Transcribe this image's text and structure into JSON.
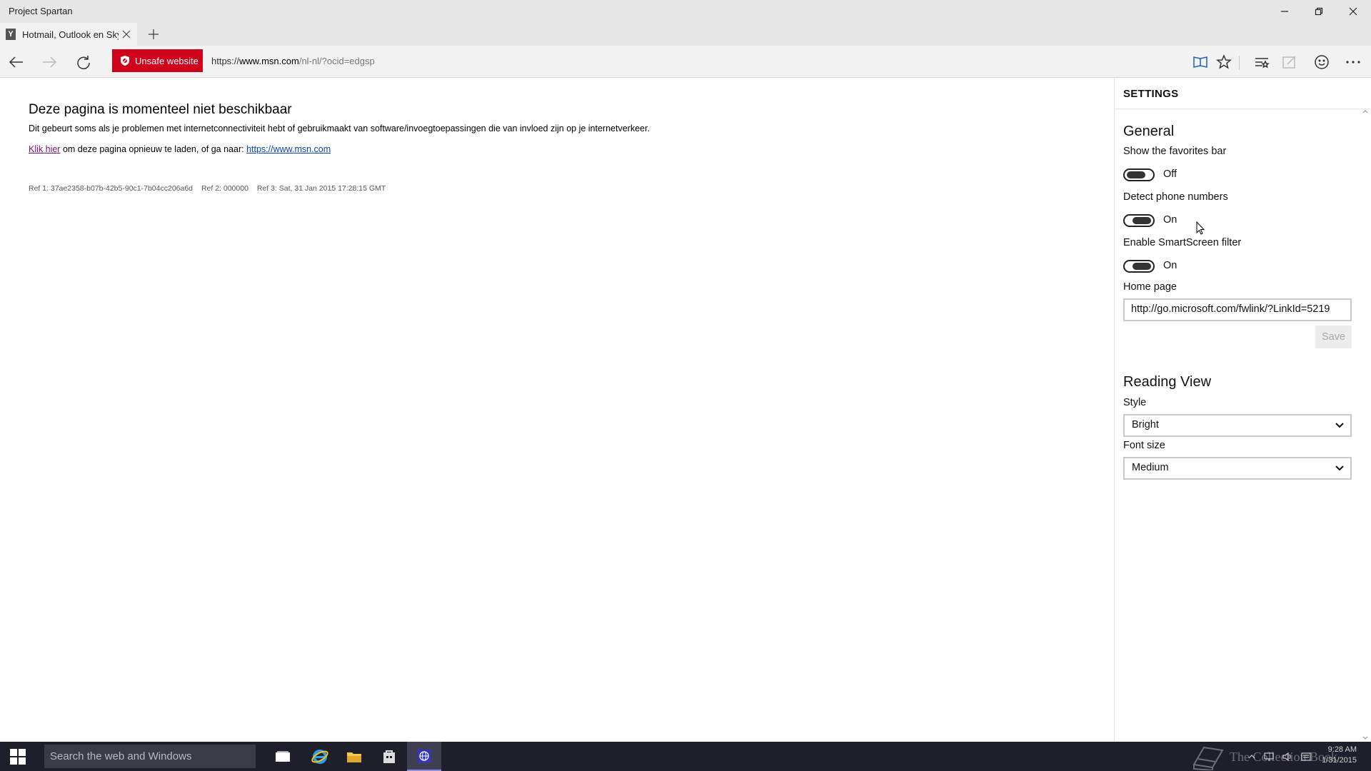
{
  "window": {
    "title": "Project Spartan"
  },
  "tabs": [
    {
      "label": "Hotmail, Outlook en Sky..."
    }
  ],
  "navbar": {
    "unsafe_label": "Unsafe website",
    "url_scheme": "https://",
    "url_host": "www.msn.com",
    "url_path": "/nl-nl/?ocid=edgsp"
  },
  "page": {
    "title": "Deze pagina is momenteel niet beschikbaar",
    "description": "Dit gebeurt soms als je problemen met internetconnectiviteit hebt of gebruikmaakt van software/invoegtoepassingen die van invloed zijn op je internetverkeer.",
    "retry_link": "Klik hier",
    "retry_text": " om deze pagina opnieuw te laden, of ga naar: ",
    "retry_url": "https://www.msn.com",
    "ref1": "Ref 1: 37ae2358-b07b-42b5-90c1-7b04cc206a6d",
    "ref2": "Ref 2: 000000",
    "ref3": "Ref 3: Sat, 31 Jan 2015 17:28:15 GMT"
  },
  "settings": {
    "header": "SETTINGS",
    "general_title": "General",
    "favorites_bar_label": "Show the favorites bar",
    "favorites_bar_state": "Off",
    "phone_numbers_label": "Detect phone numbers",
    "phone_numbers_state": "On",
    "smartscreen_label": "Enable SmartScreen filter",
    "smartscreen_state": "On",
    "home_page_label": "Home page",
    "home_page_value": "http://go.microsoft.com/fwlink/?LinkId=5219",
    "save_label": "Save",
    "reading_view_title": "Reading View",
    "style_label": "Style",
    "style_value": "Bright",
    "font_size_label": "Font size",
    "font_size_value": "Medium"
  },
  "taskbar": {
    "search_placeholder": "Search the web and Windows",
    "watermark": "The Collection Book",
    "time": "9:28 AM",
    "date": "1/31/2015"
  },
  "icons": {
    "back": "back-arrow-icon",
    "forward": "forward-arrow-icon",
    "refresh": "refresh-icon",
    "reading": "reading-view-icon",
    "favorite": "star-icon",
    "hub": "hub-icon",
    "note": "web-note-icon",
    "feedback": "smiley-icon",
    "more": "more-icon"
  },
  "colors": {
    "unsafe_red": "#d0021b",
    "visited_link": "#7a0f7a",
    "link": "#0645ad",
    "taskbar": "#1f1f2b"
  }
}
